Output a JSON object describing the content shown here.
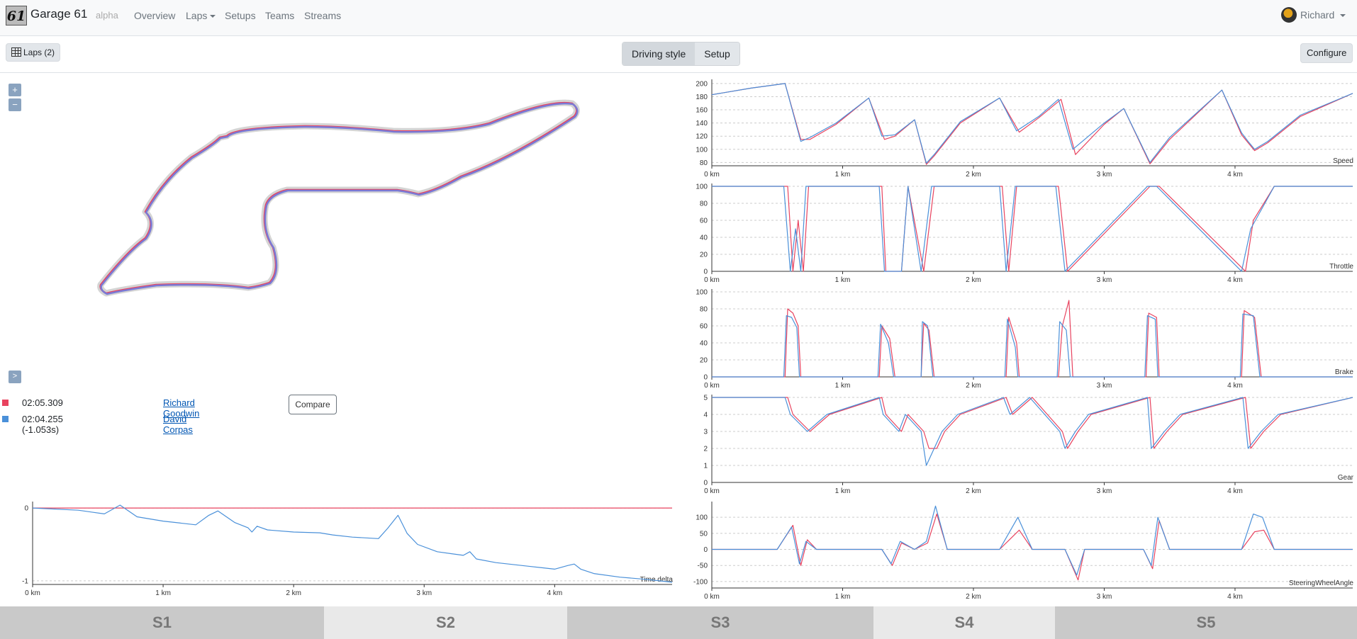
{
  "navbar": {
    "logo_text": "61",
    "brand": "Garage 61",
    "tag": "alpha",
    "links": [
      {
        "label": "Overview"
      },
      {
        "label": "Laps",
        "dropdown": true
      },
      {
        "label": "Setups"
      },
      {
        "label": "Teams"
      },
      {
        "label": "Streams"
      }
    ],
    "user": "Richard"
  },
  "toolbar": {
    "laps_button": "Laps (2)",
    "modes": [
      "Driving style",
      "Setup"
    ],
    "active_mode": "Driving style",
    "configure": "Configure"
  },
  "map": {
    "zoom_in": "+",
    "zoom_out": "−",
    "expand": ">"
  },
  "laps": [
    {
      "time": "02:05.309",
      "driver": "Richard Goodwin",
      "color": "#e8435f"
    },
    {
      "time": "02:04.255 (-1.053s)",
      "driver": "David Corpas",
      "color": "#4a90d9"
    }
  ],
  "compare_button": "Compare",
  "colors": {
    "lap_red": "#e8435f",
    "lap_blue": "#4a90d9",
    "accent": "#8aa3bf"
  },
  "chart_data": [
    {
      "type": "line",
      "title": "Time delta",
      "xlabel": "",
      "ylabel": "",
      "x_ticks": [
        "0 km",
        "1 km",
        "2 km",
        "3 km",
        "4 km"
      ],
      "y_ticks": [
        0,
        -1
      ],
      "xlim": [
        0,
        4.9
      ],
      "ylim": [
        -1.05,
        0.05
      ],
      "series": [
        {
          "color": "#e8435f",
          "x": [
            0,
            4.9
          ],
          "y": [
            0,
            0
          ]
        },
        {
          "color": "#4a90d9",
          "x": [
            0,
            0.35,
            0.55,
            0.67,
            0.8,
            1.0,
            1.25,
            1.35,
            1.42,
            1.55,
            1.65,
            1.68,
            1.72,
            1.8,
            2.0,
            2.2,
            2.3,
            2.45,
            2.65,
            2.72,
            2.8,
            2.87,
            2.95,
            3.1,
            3.3,
            3.35,
            3.4,
            3.55,
            3.8,
            4.0,
            4.1,
            4.15,
            4.2,
            4.3,
            4.5,
            4.7,
            4.9
          ],
          "y": [
            0,
            -0.03,
            -0.08,
            0.04,
            -0.12,
            -0.18,
            -0.23,
            -0.1,
            -0.04,
            -0.2,
            -0.27,
            -0.33,
            -0.25,
            -0.3,
            -0.33,
            -0.34,
            -0.37,
            -0.4,
            -0.42,
            -0.28,
            -0.1,
            -0.35,
            -0.5,
            -0.6,
            -0.65,
            -0.6,
            -0.7,
            -0.75,
            -0.8,
            -0.84,
            -0.79,
            -0.77,
            -0.84,
            -0.9,
            -0.95,
            -0.98,
            -1.02
          ]
        }
      ]
    },
    {
      "type": "line",
      "title": "Speed",
      "x_ticks": [
        "0 km",
        "1 km",
        "2 km",
        "3 km",
        "4 km"
      ],
      "y_ticks": [
        80,
        100,
        120,
        140,
        160,
        180,
        200
      ],
      "xlim": [
        0,
        4.9
      ],
      "ylim": [
        75,
        202
      ],
      "series": [
        {
          "color": "#e8435f",
          "x": [
            0,
            0.3,
            0.56,
            0.68,
            0.75,
            0.95,
            1.2,
            1.32,
            1.4,
            1.55,
            1.64,
            1.7,
            1.9,
            2.2,
            2.35,
            2.5,
            2.67,
            2.78,
            3.0,
            3.15,
            3.35,
            3.5,
            3.9,
            4.05,
            4.1,
            4.15,
            4.25,
            4.5,
            4.9
          ],
          "y": [
            183,
            193,
            200,
            115,
            115,
            138,
            178,
            115,
            120,
            145,
            77,
            90,
            140,
            178,
            126,
            148,
            176,
            92,
            138,
            162,
            78,
            115,
            190,
            122,
            110,
            98,
            110,
            150,
            185
          ]
        },
        {
          "color": "#4a90d9",
          "x": [
            0,
            0.3,
            0.56,
            0.68,
            0.75,
            0.95,
            1.2,
            1.3,
            1.4,
            1.55,
            1.64,
            1.7,
            1.9,
            2.2,
            2.33,
            2.5,
            2.65,
            2.76,
            3.0,
            3.15,
            3.35,
            3.5,
            3.9,
            4.05,
            4.1,
            4.15,
            4.25,
            4.5,
            4.9
          ],
          "y": [
            183,
            193,
            200,
            112,
            118,
            140,
            178,
            120,
            122,
            145,
            79,
            92,
            142,
            178,
            128,
            150,
            176,
            100,
            140,
            162,
            80,
            118,
            190,
            125,
            112,
            100,
            112,
            152,
            185
          ]
        }
      ]
    },
    {
      "type": "line",
      "title": "Throttle",
      "x_ticks": [
        "0 km",
        "1 km",
        "2 km",
        "3 km",
        "4 km"
      ],
      "y_ticks": [
        0,
        20,
        40,
        60,
        80,
        100
      ],
      "xlim": [
        0,
        4.9
      ],
      "ylim": [
        0,
        100
      ],
      "series": [
        {
          "color": "#e8435f",
          "x": [
            0,
            0.58,
            0.62,
            0.66,
            0.7,
            0.74,
            0.8,
            1.3,
            1.33,
            1.45,
            1.5,
            1.62,
            1.7,
            2.22,
            2.27,
            2.33,
            2.65,
            2.72,
            3.35,
            3.42,
            4.08,
            4.14,
            4.3,
            4.9
          ],
          "y": [
            100,
            100,
            0,
            60,
            0,
            100,
            100,
            100,
            0,
            0,
            100,
            0,
            100,
            100,
            0,
            100,
            100,
            0,
            100,
            100,
            0,
            60,
            100,
            100
          ]
        },
        {
          "color": "#4a90d9",
          "x": [
            0,
            0.55,
            0.6,
            0.64,
            0.68,
            0.72,
            0.8,
            1.28,
            1.32,
            1.45,
            1.5,
            1.6,
            1.68,
            2.2,
            2.25,
            2.32,
            2.63,
            2.7,
            3.33,
            3.4,
            4.05,
            4.12,
            4.3,
            4.9
          ],
          "y": [
            100,
            100,
            0,
            50,
            0,
            100,
            100,
            100,
            0,
            0,
            100,
            0,
            100,
            100,
            0,
            100,
            100,
            0,
            100,
            100,
            0,
            50,
            100,
            100
          ]
        }
      ]
    },
    {
      "type": "line",
      "title": "Brake",
      "x_ticks": [
        "0 km",
        "1 km",
        "2 km",
        "3 km",
        "4 km"
      ],
      "y_ticks": [
        0,
        20,
        40,
        60,
        80,
        100
      ],
      "xlim": [
        0,
        4.9
      ],
      "ylim": [
        0,
        100
      ],
      "series": [
        {
          "color": "#e8435f",
          "x": [
            0,
            0.56,
            0.58,
            0.62,
            0.66,
            0.68,
            0.7,
            1.28,
            1.3,
            1.36,
            1.4,
            1.6,
            1.62,
            1.66,
            1.7,
            2.25,
            2.27,
            2.33,
            2.35,
            2.65,
            2.68,
            2.73,
            2.76,
            3.32,
            3.34,
            3.4,
            3.42,
            4.05,
            4.07,
            4.15,
            4.2,
            4.9
          ],
          "y": [
            0,
            0,
            80,
            75,
            60,
            0,
            0,
            0,
            60,
            45,
            0,
            0,
            63,
            55,
            0,
            0,
            70,
            40,
            0,
            0,
            60,
            90,
            0,
            0,
            75,
            70,
            0,
            0,
            78,
            70,
            0,
            0
          ]
        },
        {
          "color": "#4a90d9",
          "x": [
            0,
            0.55,
            0.57,
            0.61,
            0.65,
            0.67,
            0.7,
            1.27,
            1.29,
            1.35,
            1.39,
            1.6,
            1.61,
            1.65,
            1.69,
            2.24,
            2.26,
            2.32,
            2.34,
            2.64,
            2.66,
            2.71,
            2.74,
            3.31,
            3.33,
            3.39,
            3.41,
            4.04,
            4.06,
            4.14,
            4.19,
            4.9
          ],
          "y": [
            0,
            0,
            72,
            70,
            58,
            0,
            0,
            0,
            62,
            40,
            0,
            0,
            65,
            60,
            0,
            0,
            68,
            35,
            0,
            0,
            65,
            55,
            0,
            0,
            72,
            68,
            0,
            0,
            74,
            72,
            0,
            0
          ]
        }
      ]
    },
    {
      "type": "line",
      "title": "Gear",
      "x_ticks": [
        "0 km",
        "1 km",
        "2 km",
        "3 km",
        "4 km"
      ],
      "y_ticks": [
        0,
        1,
        2,
        3,
        4,
        5
      ],
      "xlim": [
        0,
        4.9
      ],
      "ylim": [
        0,
        5
      ],
      "series": [
        {
          "color": "#e8435f",
          "x": [
            0,
            0.58,
            0.62,
            0.75,
            0.9,
            1.3,
            1.33,
            1.45,
            1.5,
            1.62,
            1.66,
            1.72,
            1.78,
            1.9,
            2.25,
            2.3,
            2.45,
            2.68,
            2.72,
            2.8,
            2.9,
            3.35,
            3.38,
            3.48,
            3.6,
            4.08,
            4.12,
            4.22,
            4.35,
            4.9
          ],
          "y": [
            5,
            5,
            4,
            3,
            4,
            5,
            4,
            3,
            4,
            3,
            2,
            2,
            3,
            4,
            5,
            4,
            5,
            3,
            2,
            3,
            4,
            5,
            2,
            3,
            4,
            5,
            2,
            3,
            4,
            5
          ]
        },
        {
          "color": "#4a90d9",
          "x": [
            0,
            0.56,
            0.6,
            0.73,
            0.88,
            1.28,
            1.31,
            1.43,
            1.48,
            1.6,
            1.64,
            1.7,
            1.76,
            1.88,
            2.23,
            2.28,
            2.43,
            2.66,
            2.7,
            2.78,
            2.88,
            3.33,
            3.36,
            3.46,
            3.58,
            4.06,
            4.1,
            4.2,
            4.33,
            4.9
          ],
          "y": [
            5,
            5,
            4,
            3,
            4,
            5,
            4,
            3,
            4,
            3,
            1,
            2,
            3,
            4,
            5,
            4,
            5,
            3,
            2,
            3,
            4,
            5,
            2,
            3,
            4,
            5,
            2,
            3,
            4,
            5
          ]
        }
      ]
    },
    {
      "type": "line",
      "title": "SteeringWheelAngle",
      "x_ticks": [
        "0 km",
        "1 km",
        "2 km",
        "3 km",
        "4 km"
      ],
      "y_ticks": [
        100,
        50,
        0,
        -50,
        -100
      ],
      "xlim": [
        0,
        4.9
      ],
      "ylim": [
        -120,
        140
      ],
      "series": [
        {
          "color": "#e8435f",
          "x": [
            0,
            0.5,
            0.62,
            0.68,
            0.73,
            0.8,
            1.3,
            1.38,
            1.45,
            1.55,
            1.65,
            1.72,
            1.8,
            2.2,
            2.35,
            2.45,
            2.7,
            2.8,
            2.85,
            3.3,
            3.37,
            3.42,
            3.5,
            4.05,
            4.15,
            4.22,
            4.3,
            4.9
          ],
          "y": [
            0,
            0,
            75,
            -50,
            30,
            0,
            0,
            -50,
            20,
            0,
            20,
            110,
            0,
            0,
            60,
            0,
            0,
            -95,
            0,
            0,
            -60,
            90,
            0,
            0,
            55,
            60,
            0,
            0
          ]
        },
        {
          "color": "#4a90d9",
          "x": [
            0,
            0.5,
            0.61,
            0.67,
            0.72,
            0.8,
            1.3,
            1.37,
            1.44,
            1.55,
            1.64,
            1.71,
            1.8,
            2.2,
            2.34,
            2.45,
            2.7,
            2.79,
            2.85,
            3.3,
            3.36,
            3.41,
            3.5,
            4.05,
            4.14,
            4.21,
            4.3,
            4.9
          ],
          "y": [
            0,
            0,
            70,
            -45,
            25,
            0,
            0,
            -45,
            25,
            0,
            25,
            135,
            0,
            0,
            100,
            0,
            0,
            -80,
            0,
            0,
            -50,
            100,
            0,
            0,
            110,
            100,
            0,
            0
          ]
        }
      ]
    }
  ],
  "sectors": [
    "S1",
    "S2",
    "S3",
    "S4",
    "S5"
  ]
}
